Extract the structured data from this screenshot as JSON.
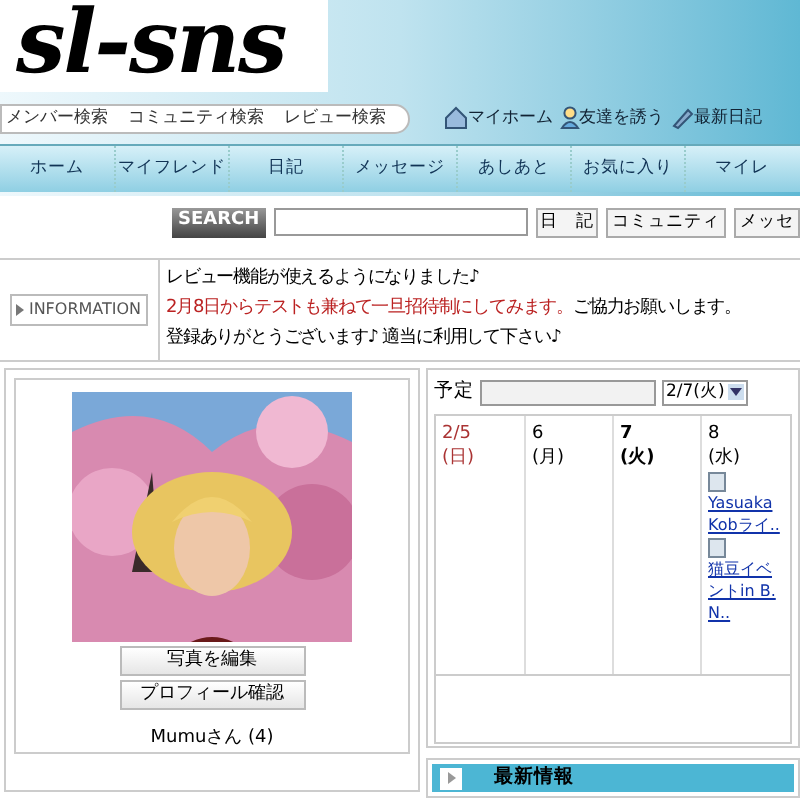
{
  "logo": "sl-sns",
  "search_links": [
    "メンバー検索",
    "コミュニティ検索",
    "レビュー検索"
  ],
  "quick_links": [
    {
      "kind": "home",
      "label": "マイホーム"
    },
    {
      "kind": "friend",
      "label": "友達を誘う"
    },
    {
      "kind": "diary",
      "label": "最新日記"
    }
  ],
  "nav": [
    "ホーム",
    "マイフレンド",
    "日記",
    "メッセージ",
    "あしあと",
    "お気に入り",
    "マイレ"
  ],
  "search": {
    "label": "SEARCH",
    "buttons": [
      "日　記",
      "コミュニティ",
      "メッセ"
    ]
  },
  "information": {
    "label": "INFORMATION",
    "lines": [
      {
        "parts": [
          {
            "text": "レビュー機能が使えるようになりました♪",
            "kind": "plain"
          }
        ]
      },
      {
        "parts": [
          {
            "text": "2月8日からテストも兼ねて一旦招待制にしてみます。",
            "kind": "red"
          },
          {
            "text": "ご協力お願いします。",
            "kind": "plain"
          }
        ]
      },
      {
        "parts": [
          {
            "text": "登録ありがとうございます♪ 適当に利用して下さい♪",
            "kind": "plain"
          }
        ]
      }
    ]
  },
  "profile": {
    "buttons": [
      "写真を編集",
      "プロフィール確認"
    ],
    "name": "Mumuさん (4)"
  },
  "schedule": {
    "label": "予定",
    "date": "2/7(火)",
    "days": [
      {
        "date": "2/5",
        "weekday": "(日)",
        "kind": "sunday"
      },
      {
        "date": "6",
        "weekday": "(月)",
        "kind": "normal"
      },
      {
        "date": "7",
        "weekday": "(火)",
        "kind": "today"
      },
      {
        "date": "8",
        "weekday": "(水)",
        "kind": "normal",
        "events": [
          "Yasuaka Kobライ..",
          "猫豆イベントin B.N.."
        ]
      }
    ]
  },
  "latest": {
    "title": "最新情報"
  }
}
